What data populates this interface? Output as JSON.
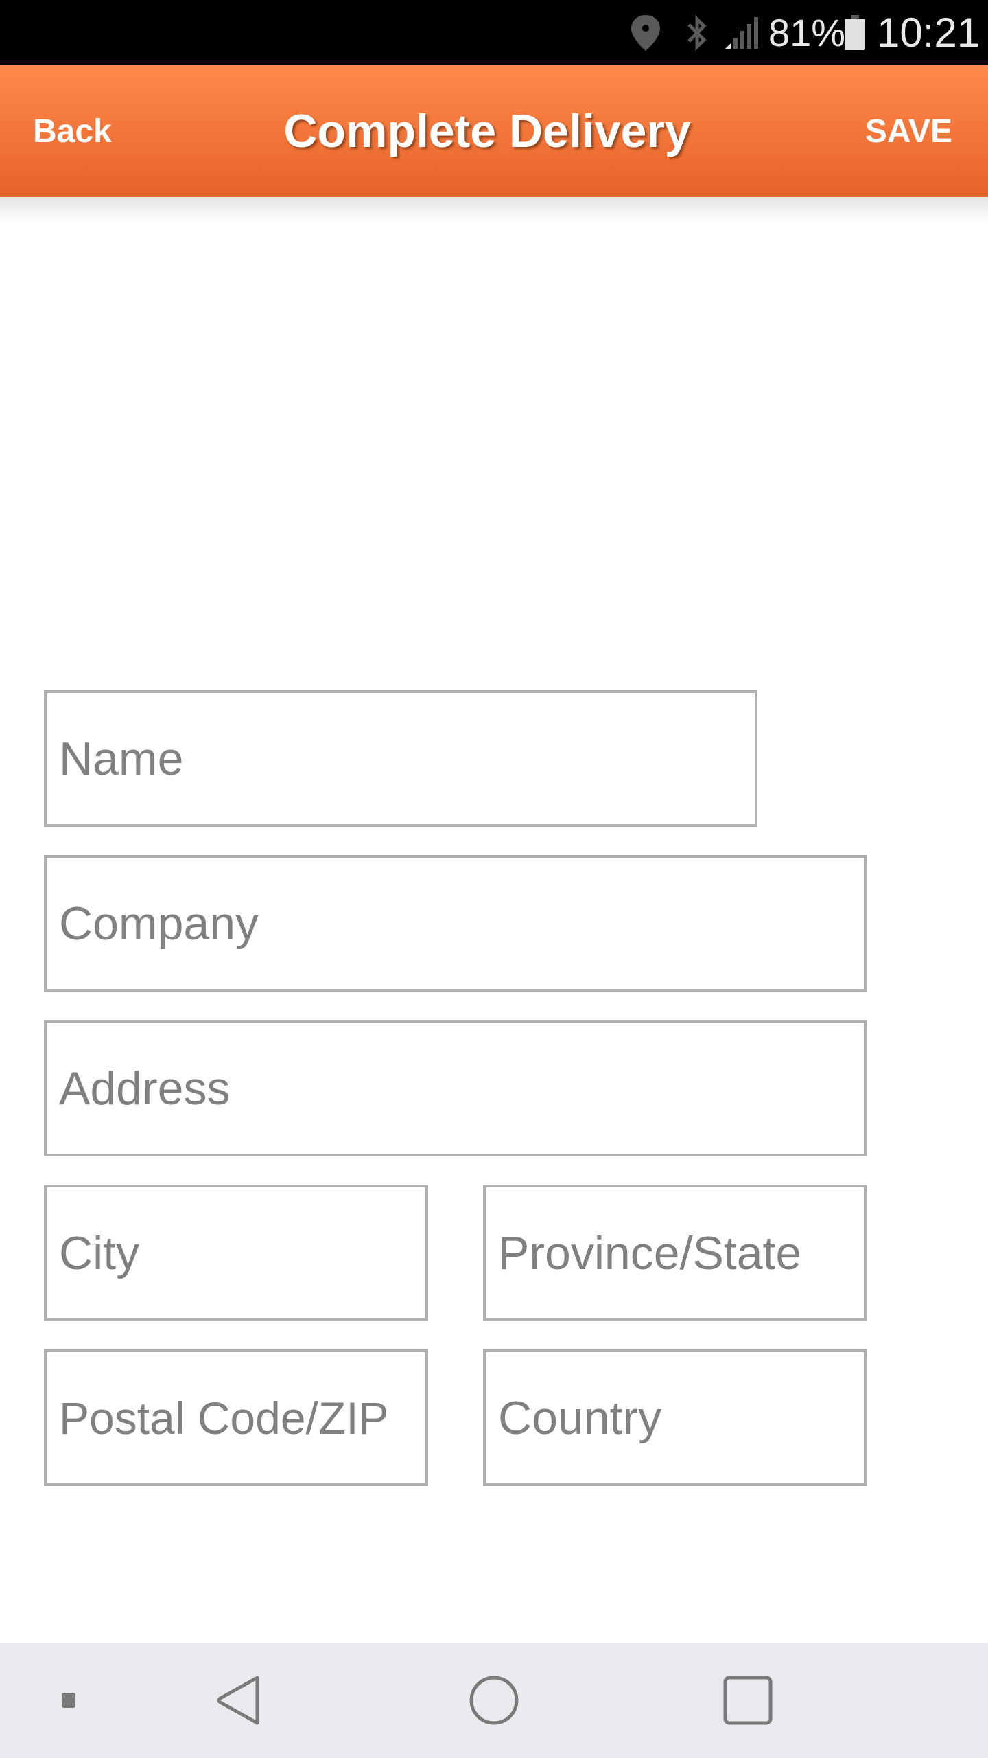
{
  "status_bar": {
    "icons": [
      "location-icon",
      "bluetooth-icon",
      "signal-icon",
      "battery-icon"
    ],
    "battery_percent": "81%",
    "time": "10:21"
  },
  "header": {
    "back_label": "Back",
    "title": "Complete Delivery",
    "save_label": "SAVE",
    "accent_color": "#f07537"
  },
  "form": {
    "name": {
      "placeholder": "Name",
      "value": ""
    },
    "company": {
      "placeholder": "Company",
      "value": ""
    },
    "address": {
      "placeholder": "Address",
      "value": ""
    },
    "city": {
      "placeholder": "City",
      "value": ""
    },
    "province": {
      "placeholder": "Province/State",
      "value": ""
    },
    "postal": {
      "placeholder": "Postal Code/ZIP",
      "value": ""
    },
    "country": {
      "placeholder": "Country",
      "value": ""
    }
  },
  "nav_bar": {
    "buttons": [
      "menu-dot-icon",
      "back-triangle-icon",
      "home-circle-icon",
      "recents-square-icon"
    ]
  }
}
